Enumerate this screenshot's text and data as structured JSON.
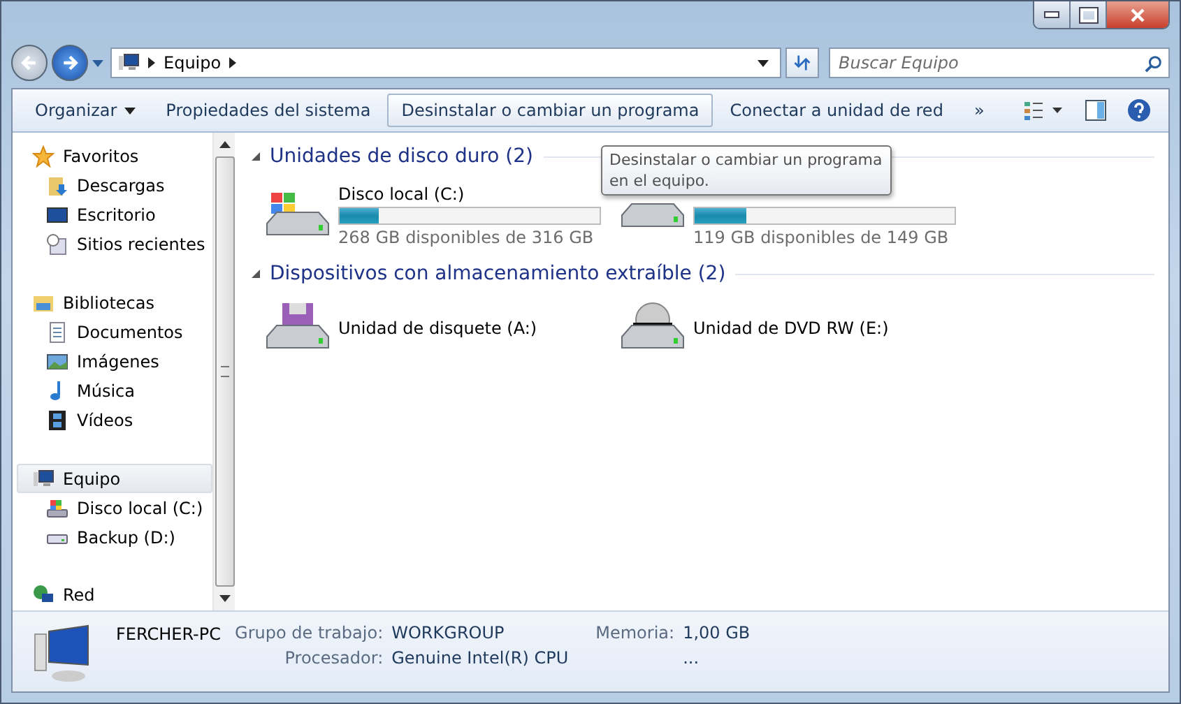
{
  "address": {
    "crumbs": [
      "Equipo"
    ]
  },
  "search": {
    "placeholder": "Buscar Equipo"
  },
  "toolbar": {
    "buttons": [
      {
        "label": "Organizar",
        "kind": "menu",
        "selected": false
      },
      {
        "label": "Propiedades del sistema",
        "kind": "plain",
        "selected": false
      },
      {
        "label": "Desinstalar o cambiar un programa",
        "kind": "plain",
        "selected": true
      },
      {
        "label": "Conectar a unidad de red",
        "kind": "plain",
        "selected": false
      },
      {
        "label": "»",
        "kind": "more",
        "selected": false
      }
    ]
  },
  "sidebar": {
    "groups": [
      {
        "label": "Favoritos",
        "kind": "star",
        "selected": false,
        "children": [
          {
            "label": "Descargas",
            "kind": "download"
          },
          {
            "label": "Escritorio",
            "kind": "desktop"
          },
          {
            "label": "Sitios recientes",
            "kind": "recent"
          }
        ]
      },
      {
        "label": "Bibliotecas",
        "kind": "library",
        "selected": false,
        "children": [
          {
            "label": "Documentos",
            "kind": "document"
          },
          {
            "label": "Imágenes",
            "kind": "image"
          },
          {
            "label": "Música",
            "kind": "music"
          },
          {
            "label": "Vídeos",
            "kind": "video"
          }
        ]
      },
      {
        "label": "Equipo",
        "kind": "computer",
        "selected": true,
        "children": [
          {
            "label": "Disco local (C:)",
            "kind": "windrive"
          },
          {
            "label": "Backup (D:)",
            "kind": "drive"
          }
        ]
      },
      {
        "label": "Red",
        "kind": "network",
        "selected": false
      }
    ]
  },
  "sections": [
    {
      "title": "Unidades de disco duro (2)",
      "items": [
        {
          "name": "Disco local (C:)",
          "kind": "windrive",
          "level": 0.15,
          "free": "268 GB disponibles de 316 GB"
        },
        {
          "kind": "drive",
          "level": 0.2,
          "free": "119 GB disponibles de 149 GB"
        }
      ]
    },
    {
      "title": "Dispositivos con almacenamiento extraíble (2)",
      "items": [
        {
          "name": "Unidad de disquete (A:)",
          "kind": "floppy"
        },
        {
          "name": "Unidad de DVD RW (E:)",
          "kind": "dvd"
        }
      ]
    }
  ],
  "tooltip": {
    "text": "Desinstalar o cambiar un programa en el equipo."
  },
  "details": {
    "name": "FERCHER-PC",
    "fields": [
      {
        "label": "Grupo de trabajo:",
        "value": "WORKGROUP"
      },
      {
        "label": "Memoria:",
        "value": "1,00 GB"
      },
      {
        "label": "Procesador:",
        "value": "Genuine Intel(R) CPU"
      },
      {
        "value": "..."
      }
    ]
  }
}
